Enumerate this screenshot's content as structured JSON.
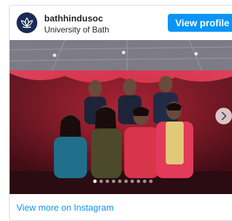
{
  "post": {
    "username": "bathhindusoc",
    "subtitle": "University of Bath",
    "view_profile_label": "View profile",
    "view_more_label": "View more on Instagram",
    "carousel": {
      "slide_count": 10,
      "active_index": 0
    }
  },
  "icons": {
    "avatar": "lotus-icon",
    "next": "chevron-right-icon"
  },
  "colors": {
    "accent": "#0a95f6",
    "avatar_bg": "#1b2a55"
  }
}
